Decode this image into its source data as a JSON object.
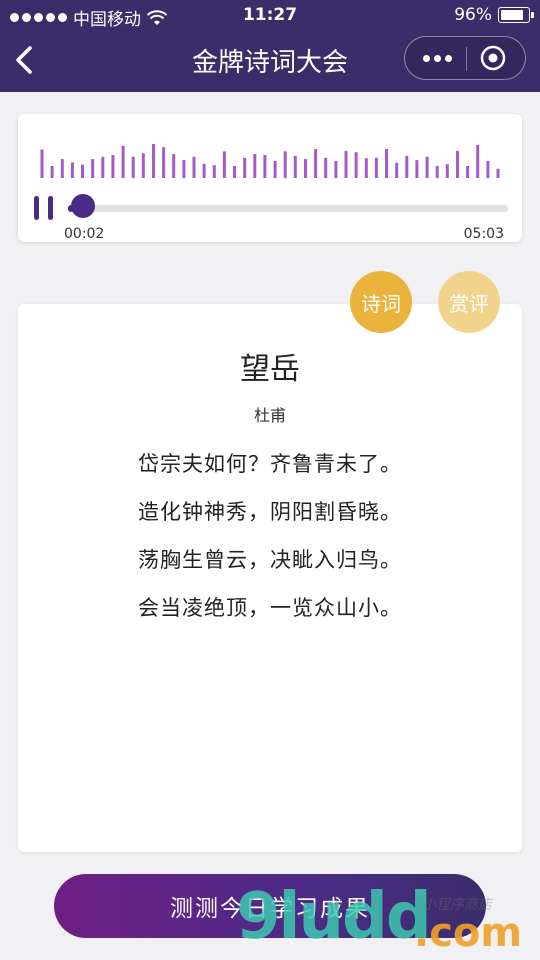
{
  "status_bar": {
    "carrier": "中国移动",
    "time": "11:27",
    "battery_percent": "96%",
    "battery_level": 0.96
  },
  "nav": {
    "title": "金牌诗词大会",
    "back_icon": "chevron-left-icon",
    "more_icon": "more-dots-icon",
    "close_icon": "target-close-icon"
  },
  "player": {
    "current_time": "00:02",
    "total_time": "05:03",
    "progress": 0.007,
    "pause_icon": "pause-icon",
    "wave_color": "#a45bc9",
    "accent_color": "#4a2b86",
    "waveform": [
      0.62,
      0.26,
      0.41,
      0.34,
      0.29,
      0.41,
      0.46,
      0.5,
      0.7,
      0.46,
      0.54,
      0.74,
      0.67,
      0.52,
      0.39,
      0.46,
      0.31,
      0.28,
      0.58,
      0.26,
      0.44,
      0.52,
      0.5,
      0.37,
      0.58,
      0.48,
      0.41,
      0.63,
      0.44,
      0.37,
      0.59,
      0.56,
      0.43,
      0.44,
      0.63,
      0.33,
      0.48,
      0.39,
      0.46,
      0.26,
      0.3,
      0.59,
      0.26,
      0.72,
      0.37,
      0.2
    ]
  },
  "tabs": {
    "poem": "诗词",
    "review": "赏评",
    "active_color": "#eab43c",
    "inactive_color": "#f2d38b"
  },
  "poem": {
    "title": "望岳",
    "author": "杜甫",
    "lines": [
      "岱宗夫如何？齐鲁青未了。",
      "造化钟神秀，阴阳割昏晓。",
      "荡胸生曾云，决眦入归鸟。",
      "会当凌绝顶，一览众山小。"
    ]
  },
  "cta": {
    "label": "测测今日学习成果"
  },
  "watermark": {
    "main": "9ludd",
    "suffix": ".com",
    "shop": "小程序商店"
  }
}
